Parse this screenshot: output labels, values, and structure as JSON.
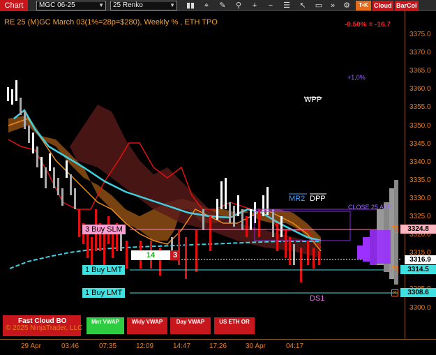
{
  "toolbar": {
    "chart_tab": "Chart",
    "instrument": "MGC 06-25",
    "bar_type": "25 Renko",
    "icons": [
      "bar-chart-icon",
      "crosshair-icon",
      "pencil-icon",
      "zoom-icon",
      "plus-icon",
      "minus-icon",
      "list-icon",
      "cursor-icon",
      "chat-icon",
      "chevrons-icon",
      "settings-icon"
    ],
    "tok_label": "T•K",
    "cloud_label": "Cloud",
    "barcol_label": "BarCol"
  },
  "chart": {
    "title": "RE 25 (M)GC March 03(1%=28p=$280), Weekly % , ETH TPO",
    "pnl": "-0.50% = -16.7",
    "y_ticks": [
      "3375.0",
      "3370.0",
      "3365.0",
      "3360.0",
      "3355.0",
      "3350.0",
      "3345.0",
      "3340.0",
      "3335.0",
      "3330.0",
      "3325.0",
      "3320.0",
      "3315.0",
      "3310.0",
      "3305.0",
      "3300.0"
    ],
    "x_ticks": [
      "29 Apr",
      "03:46",
      "07:35",
      "12:09",
      "14:47",
      "17:26",
      "30 Apr",
      "04:17"
    ],
    "price_labels": [
      {
        "text": "3324.8",
        "color": "#ffb6c1"
      },
      {
        "text": "3316.9",
        "color": "#ffffff"
      },
      {
        "text": "3314.5",
        "color": "#40e0e0"
      },
      {
        "text": "3308.6",
        "color": "#40e0e0"
      }
    ],
    "orders": [
      {
        "label": "3 Buy SLM",
        "color": "#ff80c0"
      },
      {
        "label": "1 Buy LMT",
        "color": "#40e0e0"
      },
      {
        "label": "1 Buy LMT",
        "color": "#40e0e0"
      }
    ],
    "position_qty": "14",
    "position_ticks": "3",
    "annotations": {
      "wpp": "WPP",
      "mr2": "MR2",
      "dpp": "DPP",
      "close_line": "CLOSE 25 ATR",
      "pct": "+1,0%",
      "ds1": "DS1"
    }
  },
  "chart_data": {
    "type": "line",
    "x": [
      "29 Apr",
      "03:46",
      "07:35",
      "12:09",
      "14:47",
      "17:26",
      "30 Apr",
      "04:17"
    ],
    "ylim": [
      3297,
      3378
    ],
    "series": [
      {
        "values": [
          3362,
          3348,
          3340,
          3325,
          3318,
          3322,
          3328,
          3322
        ]
      },
      {
        "values": [
          3355,
          3345,
          3340,
          3333,
          3328,
          3325,
          3327,
          3324
        ]
      },
      {
        "values": [
          3312,
          3316,
          3318,
          3319,
          3320,
          3320,
          3320,
          3320
        ]
      }
    ]
  },
  "buttons": {
    "fast_cloud": "Fast Cloud BO",
    "copyright": "© 2025 NinjaTrader, LLC",
    "mnt_vwap": "Mnt VWAP",
    "wkly_vwap": "Wkly VWAP",
    "day_vwap": "Day VWAP",
    "us_eth_or": "US ETH OR"
  },
  "colors": {
    "accent_red": "#c8161d",
    "axis_orange": "#e67e22",
    "vwap_cyan": "#40e0e0",
    "cloud_orange": "#c0701a",
    "ichimoku_red": "#e01010"
  }
}
